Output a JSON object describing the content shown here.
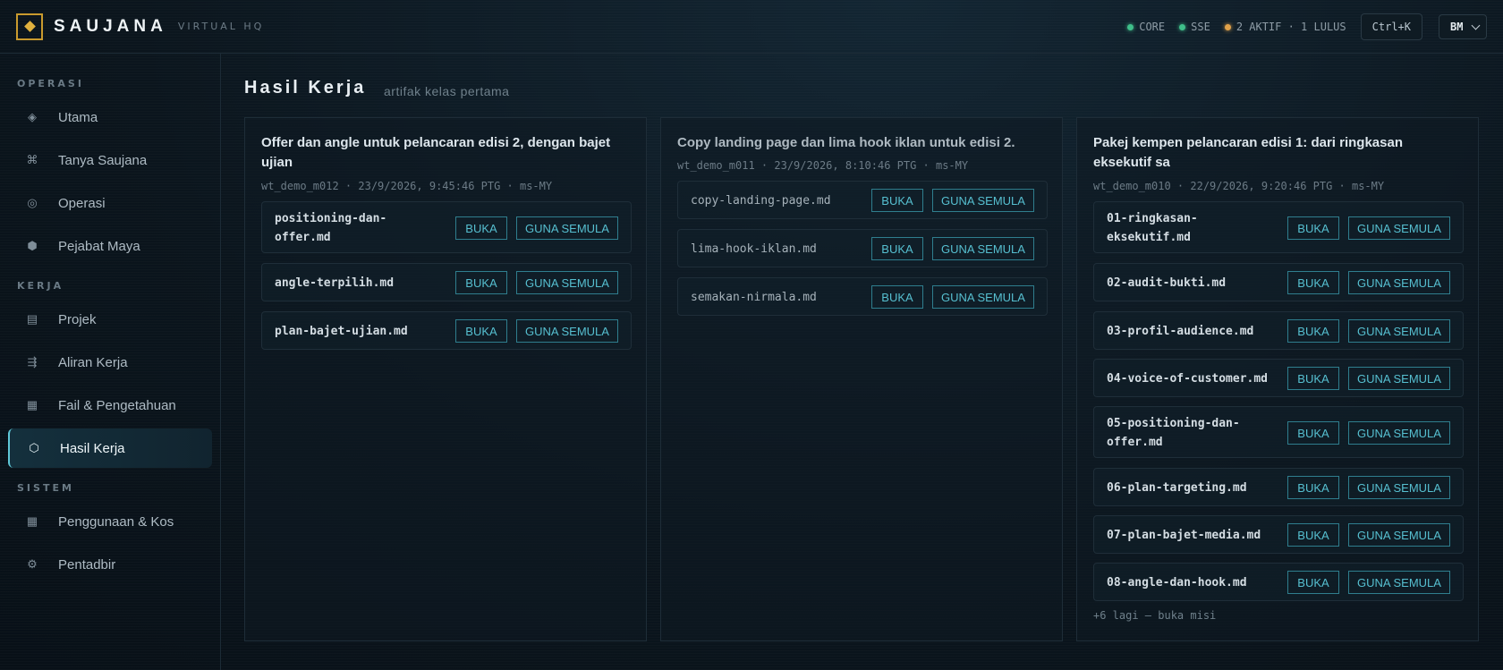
{
  "brand": {
    "name": "SAUJANA",
    "sub": "VIRTUAL HQ"
  },
  "status": {
    "core": "CORE",
    "sse": "SSE",
    "active": "2 AKTIF · 1 LULUS",
    "shortcut": "Ctrl+K",
    "language": "BM",
    "colors": {
      "ok": "#3fbf8a",
      "warn": "#e1a24a"
    }
  },
  "sidebar": {
    "sections": [
      {
        "label": "OPERASI"
      },
      {
        "label": "KERJA"
      },
      {
        "label": "SISTEM"
      }
    ],
    "items": [
      {
        "label": "Utama",
        "icon": "diamond-icon"
      },
      {
        "label": "Tanya Saujana",
        "icon": "command-icon"
      },
      {
        "label": "Operasi",
        "icon": "target-icon"
      },
      {
        "label": "Pejabat Maya",
        "icon": "hexagon-icon"
      },
      {
        "label": "Projek",
        "icon": "list-icon"
      },
      {
        "label": "Aliran Kerja",
        "icon": "flow-icon"
      },
      {
        "label": "Fail & Pengetahuan",
        "icon": "document-icon"
      },
      {
        "label": "Hasil Kerja",
        "icon": "hexagon-outline-icon",
        "active": true
      },
      {
        "label": "Penggunaan & Kos",
        "icon": "grid-icon"
      },
      {
        "label": "Pentadbir",
        "icon": "settings-icon"
      }
    ]
  },
  "page": {
    "title": "Hasil Kerja",
    "subtitle": "artifak kelas pertama"
  },
  "actions": {
    "open": "BUKA",
    "reuse": "GUNA SEMULA"
  },
  "columns": [
    {
      "title": "Offer dan angle untuk pelancaran edisi 2, dengan bajet ujian",
      "meta": "wt_demo_m012 · 23/9/2026, 9:45:46 PTG · ms-MY",
      "files": [
        "positioning-dan-offer.md",
        "angle-terpilih.md",
        "plan-bajet-ujian.md"
      ]
    },
    {
      "title": "Copy landing page dan lima hook iklan untuk edisi 2.",
      "meta": "wt_demo_m011 · 23/9/2026, 8:10:46 PTG · ms-MY",
      "files": [
        "copy-landing-page.md",
        "lima-hook-iklan.md",
        "semakan-nirmala.md"
      ]
    },
    {
      "title": "Pakej kempen pelancaran edisi 1: dari ringkasan eksekutif sa",
      "meta": "wt_demo_m010 · 22/9/2026, 9:20:46 PTG · ms-MY",
      "files": [
        "01-ringkasan-eksekutif.md",
        "02-audit-bukti.md",
        "03-profil-audience.md",
        "04-voice-of-customer.md",
        "05-positioning-dan-offer.md",
        "06-plan-targeting.md",
        "07-plan-bajet-media.md",
        "08-angle-dan-hook.md"
      ],
      "more": "+6 lagi — buka misi"
    }
  ]
}
